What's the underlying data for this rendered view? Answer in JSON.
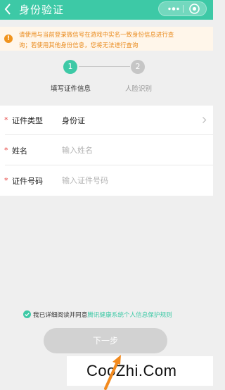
{
  "header": {
    "title": "身份验证",
    "bg_color": "#3dc9a6"
  },
  "notice": {
    "line1": "请使用与当前登录微信号在游戏中实名一致身份信息进行查",
    "line2": "询；若使用其他身份信息，您将无法进行查询",
    "icon_glyph": "!",
    "color": "#e9891a"
  },
  "steps": [
    {
      "number": "1",
      "label": "填写证件信息",
      "active": true
    },
    {
      "number": "2",
      "label": "人脸识别",
      "active": false
    }
  ],
  "form": {
    "id_type_label": "证件类型",
    "id_type_value": "身份证",
    "name_label": "姓名",
    "name_placeholder": "输入姓名",
    "id_number_label": "证件号码",
    "id_number_placeholder": "输入证件号码",
    "required_mark": "*"
  },
  "agreement": {
    "text": "我已详细阅读并同意",
    "link": "腾讯健康系统个人信息保护规则"
  },
  "next_button": "下一步",
  "watermark": "CooZhi.Com"
}
